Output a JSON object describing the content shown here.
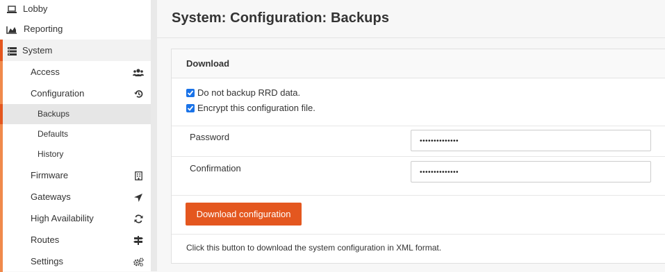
{
  "sidebar": {
    "top_items": [
      {
        "label": "Lobby",
        "icon": "laptop-icon"
      },
      {
        "label": "Reporting",
        "icon": "area-chart-icon"
      },
      {
        "label": "System",
        "icon": "server-icon"
      }
    ],
    "system_items": [
      {
        "label": "Access",
        "icon": "users-icon"
      },
      {
        "label": "Configuration",
        "icon": "history-icon"
      },
      {
        "label": "Firmware",
        "icon": "building-icon"
      },
      {
        "label": "Gateways",
        "icon": "location-arrow-icon"
      },
      {
        "label": "High Availability",
        "icon": "refresh-icon"
      },
      {
        "label": "Routes",
        "icon": "signpost-icon"
      },
      {
        "label": "Settings",
        "icon": "cogs-icon"
      }
    ],
    "configuration_items": [
      {
        "label": "Backups",
        "active": true
      },
      {
        "label": "Defaults"
      },
      {
        "label": "History"
      }
    ]
  },
  "page": {
    "title": "System: Configuration: Backups"
  },
  "download_panel": {
    "heading": "Download",
    "checkbox_rrd": {
      "label": "Do not backup RRD data.",
      "checked": true
    },
    "checkbox_encrypt": {
      "label": "Encrypt this configuration file.",
      "checked": true
    },
    "password_label": "Password",
    "password_value": "••••••••••••••",
    "confirmation_label": "Confirmation",
    "confirmation_value": "••••••••••••••",
    "button_label": "Download configuration",
    "help_text": "Click this button to download the system configuration in XML format."
  },
  "colors": {
    "accent": "#e4571f",
    "accent_light": "#f08a4b",
    "checkbox": "#1a73e8"
  }
}
